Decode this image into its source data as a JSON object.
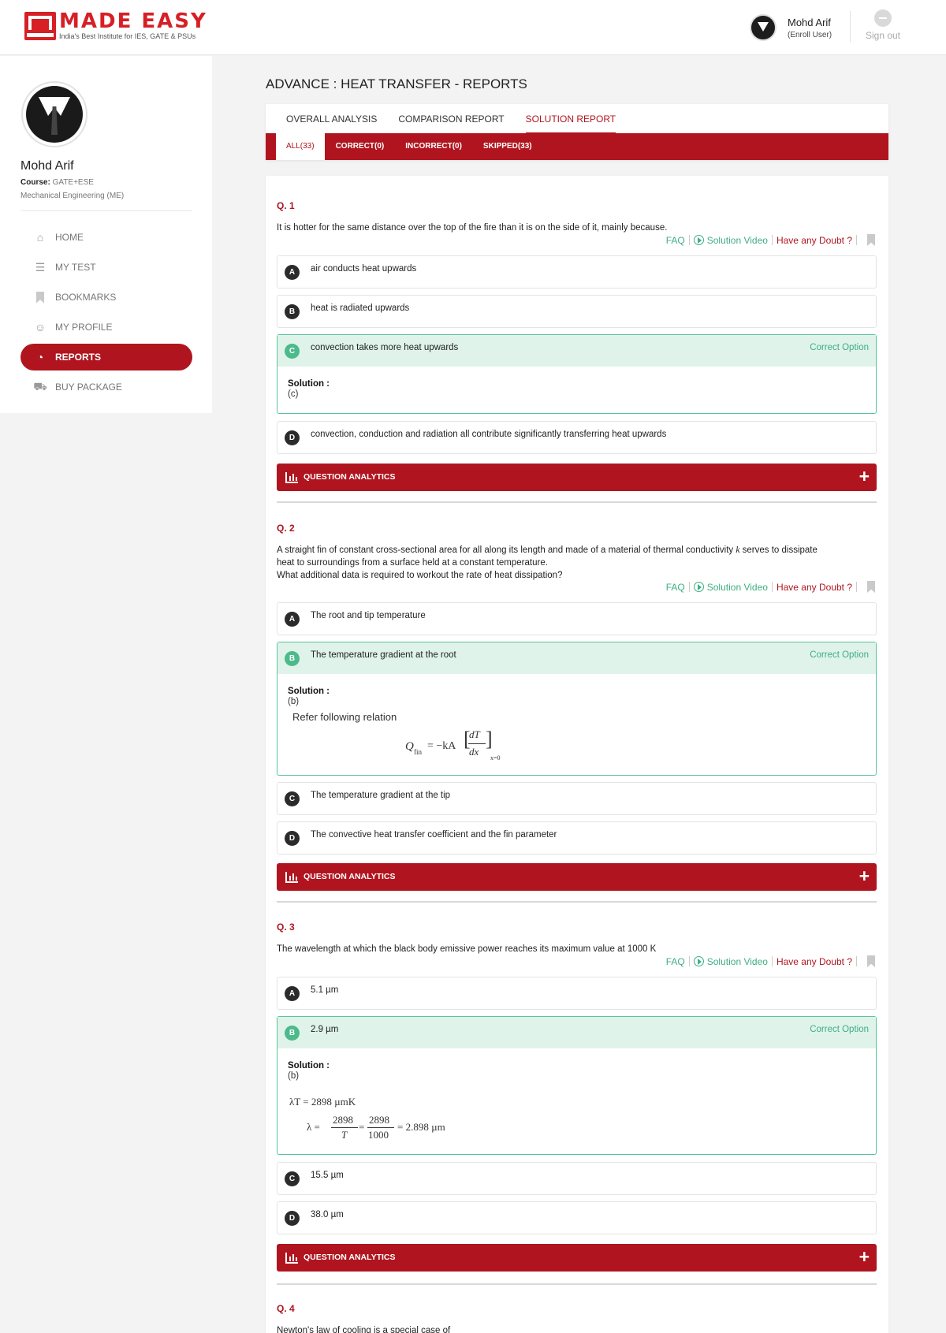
{
  "brand": {
    "title": "MADE EASY",
    "tagline": "India's Best Institute for IES, GATE & PSUs"
  },
  "header": {
    "user_name": "Mohd Arif",
    "user_role": "(Enroll User)",
    "signout_label": "Sign out"
  },
  "sidebar": {
    "name": "Mohd Arif",
    "course_label": "Course:",
    "course_value": "GATE+ESE",
    "branch": "Mechanical Engineering (ME)",
    "items": [
      {
        "label": "HOME",
        "icon": "home-icon"
      },
      {
        "label": "MY TEST",
        "icon": "test-icon"
      },
      {
        "label": "BOOKMARKS",
        "icon": "bookmark-icon"
      },
      {
        "label": "MY PROFILE",
        "icon": "user-icon"
      },
      {
        "label": "REPORTS",
        "icon": "pie-chart-icon",
        "active": true
      },
      {
        "label": "BUY PACKAGE",
        "icon": "cart-icon"
      }
    ]
  },
  "page": {
    "title": "ADVANCE : HEAT TRANSFER - REPORTS"
  },
  "tabs": [
    {
      "label": "OVERALL ANALYSIS"
    },
    {
      "label": "COMPARISON REPORT"
    },
    {
      "label": "SOLUTION REPORT",
      "active": true
    }
  ],
  "subtabs": [
    {
      "label": "ALL(33)",
      "active": true
    },
    {
      "label": "CORRECT(0)"
    },
    {
      "label": "INCORRECT(0)"
    },
    {
      "label": "SKIPPED(33)"
    }
  ],
  "actions": {
    "faq": "FAQ",
    "video": "Solution Video",
    "doubt": "Have any Doubt ?"
  },
  "labels": {
    "correct_option": "Correct Option",
    "solution": "Solution :",
    "analytics": "QUESTION ANALYTICS"
  },
  "questions": [
    {
      "number": "Q. 1",
      "text": "It is hotter for the same distance over the top of the fire than it is on the side of it, mainly because.",
      "options": [
        {
          "letter": "A",
          "text": "air conducts heat upwards"
        },
        {
          "letter": "B",
          "text": "heat is radiated upwards"
        },
        {
          "letter": "C",
          "text": "convection takes more heat upwards",
          "correct": true
        },
        {
          "letter": "D",
          "text": "convection, conduction and radiation all contribute significantly transferring heat upwards"
        }
      ],
      "solution": "(c)"
    },
    {
      "number": "Q. 2",
      "text_line1": "A straight fin of constant cross-sectional area for all along its length and made of a material of thermal conductivity",
      "text_var": "k",
      "text_line1b": "serves to dissipate",
      "text_line2": "heat to surroundings from a surface held at a constant temperature.",
      "text_line3": "What additional data is required to workout the rate of heat dissipation?",
      "options": [
        {
          "letter": "A",
          "text": "The root and tip temperature"
        },
        {
          "letter": "B",
          "text": "The temperature gradient at the root",
          "correct": true
        },
        {
          "letter": "C",
          "text": "The temperature gradient at the tip"
        },
        {
          "letter": "D",
          "text": "The convective heat transfer coefficient and the fin parameter"
        }
      ],
      "solution": "(b)",
      "solution_note": "Refer following relation",
      "equation": {
        "lhs": "Q",
        "lhs_sub": "fin",
        "rhs": "= −kA",
        "num": "dT",
        "den": "dx",
        "eval": "x=0"
      }
    },
    {
      "number": "Q. 3",
      "text": "The wavelength at which the black body emissive power reaches its maximum value at 1000 K",
      "options": [
        {
          "letter": "A",
          "text": "5.1 µm"
        },
        {
          "letter": "B",
          "text": "2.9 µm",
          "correct": true
        },
        {
          "letter": "C",
          "text": "15.5 µm"
        },
        {
          "letter": "D",
          "text": "38.0 µm"
        }
      ],
      "solution": "(b)",
      "eq1": "λT  =  2898 µmK",
      "eq2_lhs": "λ  =",
      "eq2_n1": "2898",
      "eq2_d1": "T",
      "eq2_n2": "2898",
      "eq2_d2": "1000",
      "eq2_res": "= 2.898 µm"
    },
    {
      "number": "Q. 4",
      "text": "Newton's law of cooling is a special case of"
    }
  ]
}
